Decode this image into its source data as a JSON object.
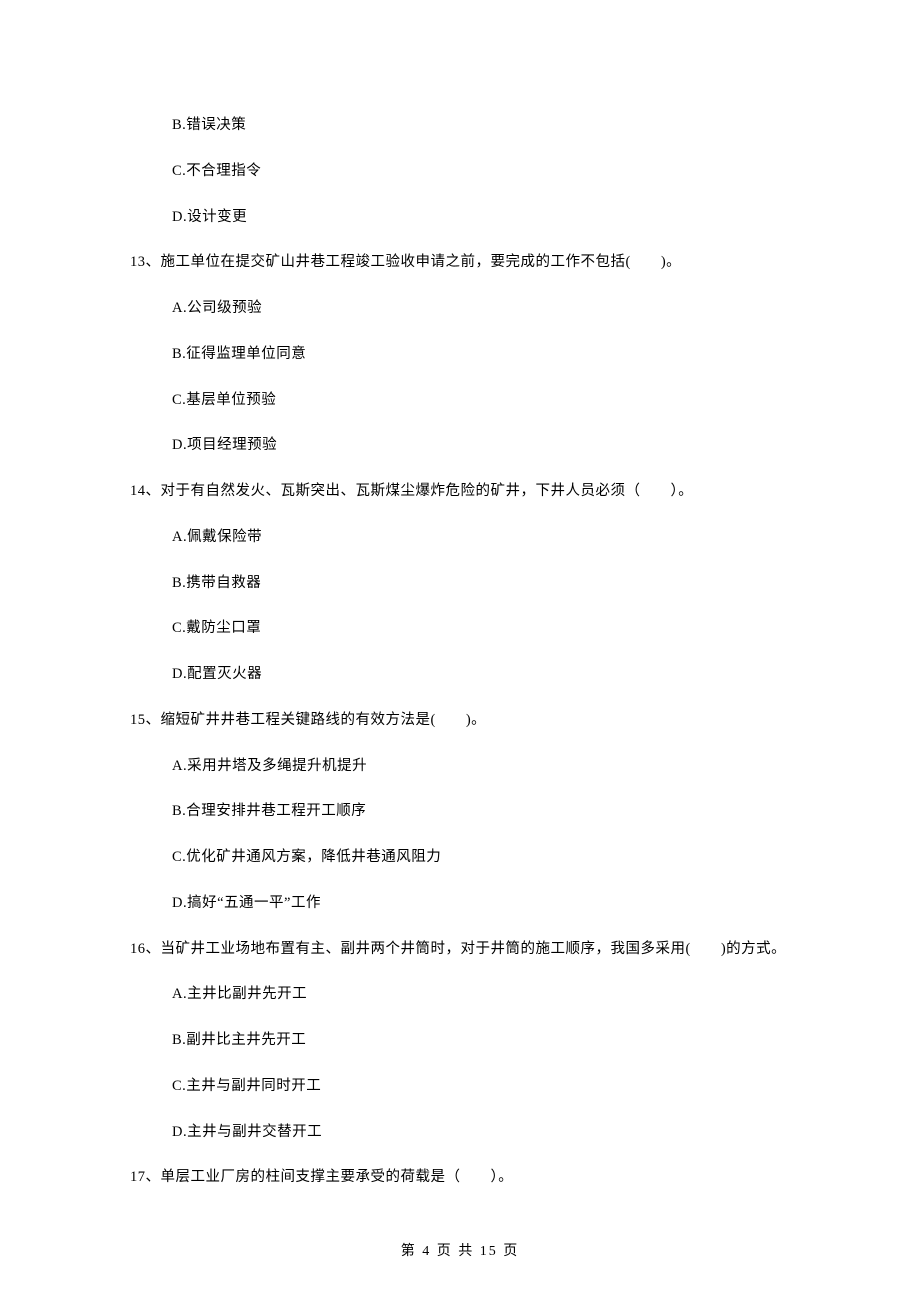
{
  "orphan_options": [
    "B.错误决策",
    "C.不合理指令",
    "D.设计变更"
  ],
  "questions": [
    {
      "stem": "13、施工单位在提交矿山井巷工程竣工验收申请之前，要完成的工作不包括(　　)。",
      "options": [
        "A.公司级预验",
        "B.征得监理单位同意",
        "C.基层单位预验",
        "D.项目经理预验"
      ]
    },
    {
      "stem": "14、对于有自然发火、瓦斯突出、瓦斯煤尘爆炸危险的矿井，下井人员必须（　　）。",
      "options": [
        "A.佩戴保险带",
        "B.携带自救器",
        "C.戴防尘口罩",
        "D.配置灭火器"
      ]
    },
    {
      "stem": "15、缩短矿井井巷工程关键路线的有效方法是(　　)。",
      "options": [
        "A.采用井塔及多绳提升机提升",
        "B.合理安排井巷工程开工顺序",
        "C.优化矿井通风方案，降低井巷通风阻力",
        "D.搞好“五通一平”工作"
      ]
    },
    {
      "stem": "16、当矿井工业场地布置有主、副井两个井筒时，对于井筒的施工顺序，我国多采用(　　)的方式。",
      "options": [
        "A.主井比副井先开工",
        "B.副井比主井先开工",
        "C.主井与副井同时开工",
        "D.主井与副井交替开工"
      ]
    },
    {
      "stem": "17、单层工业厂房的柱间支撑主要承受的荷载是（　　）。",
      "options": []
    }
  ],
  "footer": "第 4 页 共 15 页"
}
